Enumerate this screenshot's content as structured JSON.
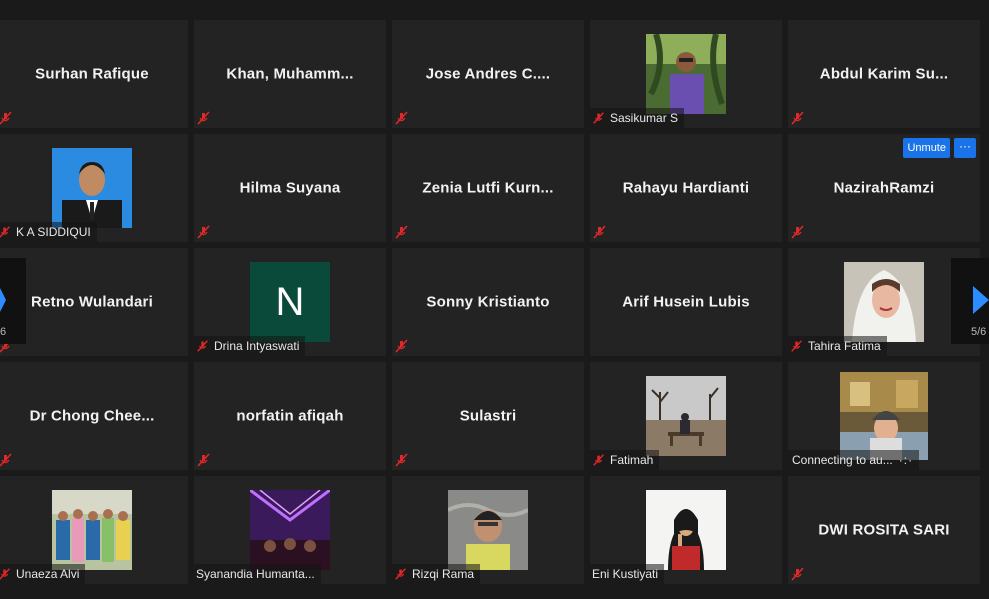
{
  "meeting": {
    "page_indicator": "5/6",
    "left_page_indicator": "6"
  },
  "tiles": [
    {
      "name": "Surhan Rafique"
    },
    {
      "name": "Khan,  Muhamm..."
    },
    {
      "name": "Jose  Andres C...."
    },
    {
      "label": "Sasikumar S"
    },
    {
      "name": "Abdul Karim Su..."
    },
    {
      "label": "K A SIDDIQUI"
    },
    {
      "name": "Hilma Suyana"
    },
    {
      "name": "Zenia Lutfi Kurn..."
    },
    {
      "name": "Rahayu Hardianti"
    },
    {
      "name": "NazirahRamzi",
      "unmute": "Unmute",
      "more": "···"
    },
    {
      "name": "Retno Wulandari"
    },
    {
      "label": "Drina Intyaswati",
      "avatar_letter": "N"
    },
    {
      "name": "Sonny Kristianto"
    },
    {
      "name": "Arif Husein Lubis"
    },
    {
      "label": "Tahira Fatima"
    },
    {
      "name": "Dr  Chong  Chee..."
    },
    {
      "name": "norfatin afiqah"
    },
    {
      "name": "Sulastri"
    },
    {
      "label": "Fatimah"
    },
    {
      "label": "Connecting to au..."
    },
    {
      "label": "Unaeza Alvi"
    },
    {
      "label": "Syanandia Humanta..."
    },
    {
      "label": "Rizqi Rama"
    },
    {
      "label": "Eni Kustiyati"
    },
    {
      "name": "DWI ROSITA SARI"
    }
  ],
  "colors": {
    "background": "#1a1a1a",
    "tile": "#232323",
    "muted_icon": "#e02828",
    "unmute_button": "#1a73e8",
    "avatar_n": "#0a4a3a",
    "pager_arrow": "#2d8cff"
  },
  "icons": {
    "muted": "microphone-muted-icon",
    "next": "chevron-right-icon",
    "prev": "chevron-left-icon"
  }
}
